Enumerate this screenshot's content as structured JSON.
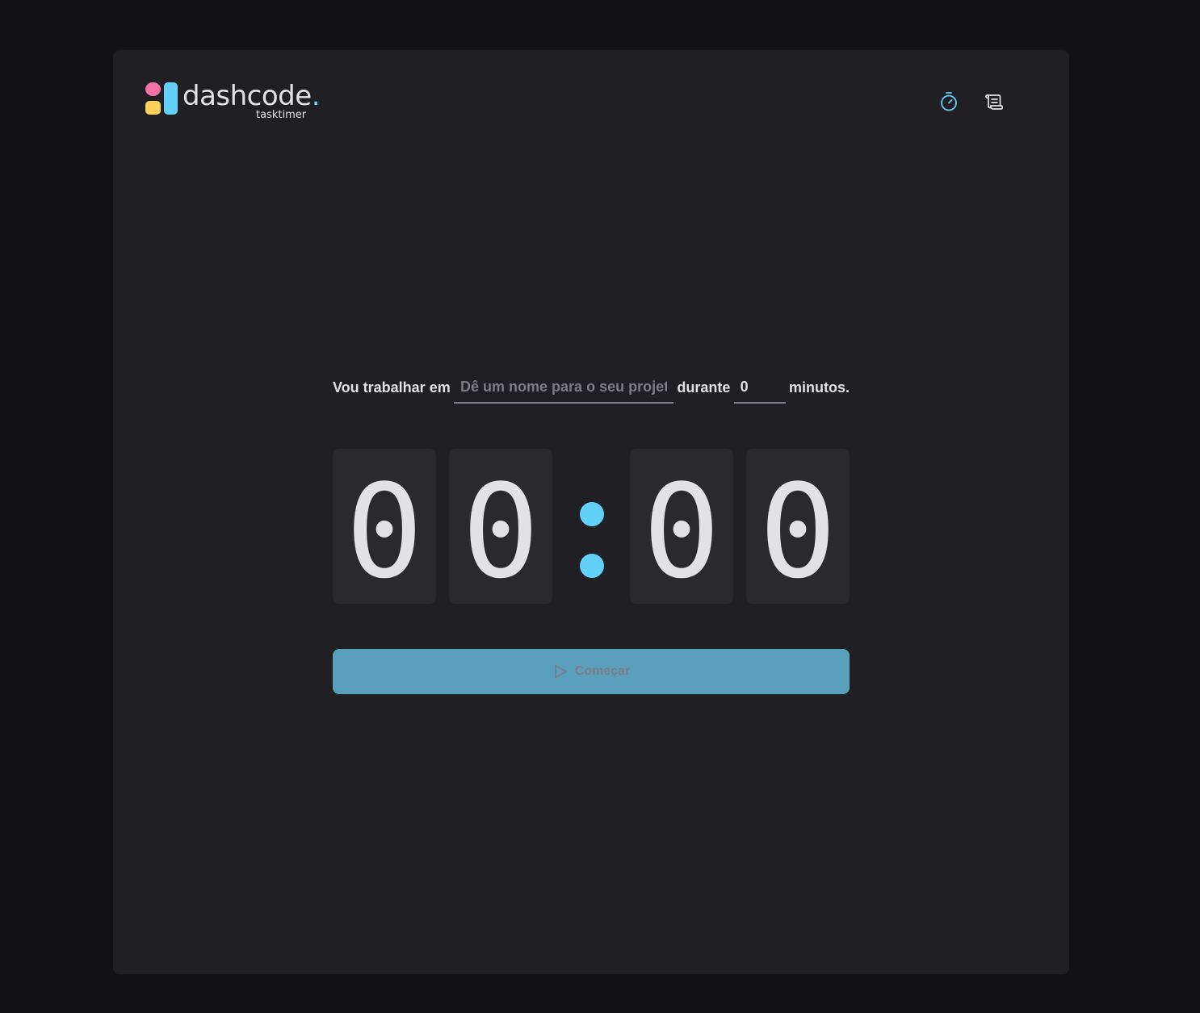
{
  "brand": {
    "name": "dashcode",
    "dot": ".",
    "product": "tasktimer",
    "colors": {
      "pink": "#f472a6",
      "yellow": "#fcd05a",
      "blue": "#62d0f8"
    }
  },
  "nav": {
    "items": [
      {
        "icon": "timer-icon",
        "active": true
      },
      {
        "icon": "scroll-icon",
        "active": false
      }
    ]
  },
  "form": {
    "task_label": "Vou trabalhar em",
    "task_placeholder": "Dê um nome para o seu projeto",
    "task_value": "",
    "duration_label": "durante",
    "minutes_value": "0",
    "minutes_suffix": "minutos."
  },
  "countdown": {
    "minutes_tens": "0",
    "minutes_ones": "0",
    "separator": ":",
    "seconds_tens": "0",
    "seconds_ones": "0"
  },
  "start_button": {
    "label": "Começar",
    "icon": "play-icon",
    "disabled": true
  },
  "theme": {
    "accent": "#62d0f8",
    "background": "#121214",
    "card": "#202024",
    "digit_bg": "#29292e",
    "text": "#e1e1e6",
    "muted": "#7c7c8a"
  }
}
